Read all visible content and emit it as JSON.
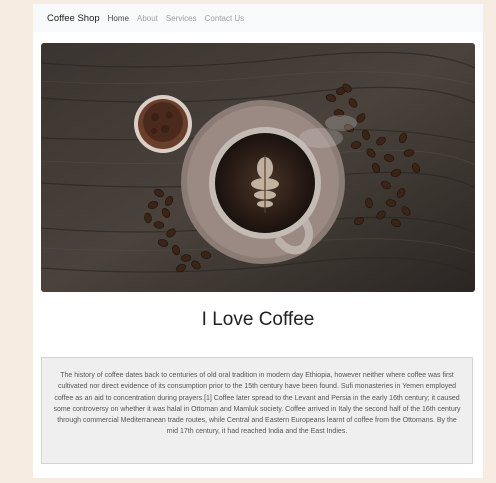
{
  "navbar": {
    "brand": "Coffee Shop",
    "links": [
      "Home",
      "About",
      "Services",
      "Contact Us"
    ],
    "active": "Home"
  },
  "hero": {
    "image_icon": "coffee-cup-image"
  },
  "main": {
    "heading": "I Love Coffee",
    "paragraph": "The history of coffee dates back to centuries of old oral tradition in modern day Ethiopia, however neither where coffee was first cultivated nor direct evidence of its consumption prior to the 15th century have been found. Sufi monasteries in Yemen employed coffee as an aid to concentration during prayers.[1] Coffee later spread to the Levant and Persia in the early 16th century; it caused some controversy on whether it was halal in Ottoman and Mamluk society. Coffee arrived in Italy the second half of the 16th century through commercial Mediterranean trade routes, while Central and Eastern Europeans learnt of coffee from the Ottomans. By the mid 17th century, it had reached India and the East Indies."
  },
  "colors": {
    "background": "#f6ece2",
    "navbar": "#f8f9fa",
    "textbox": "#efefef"
  }
}
